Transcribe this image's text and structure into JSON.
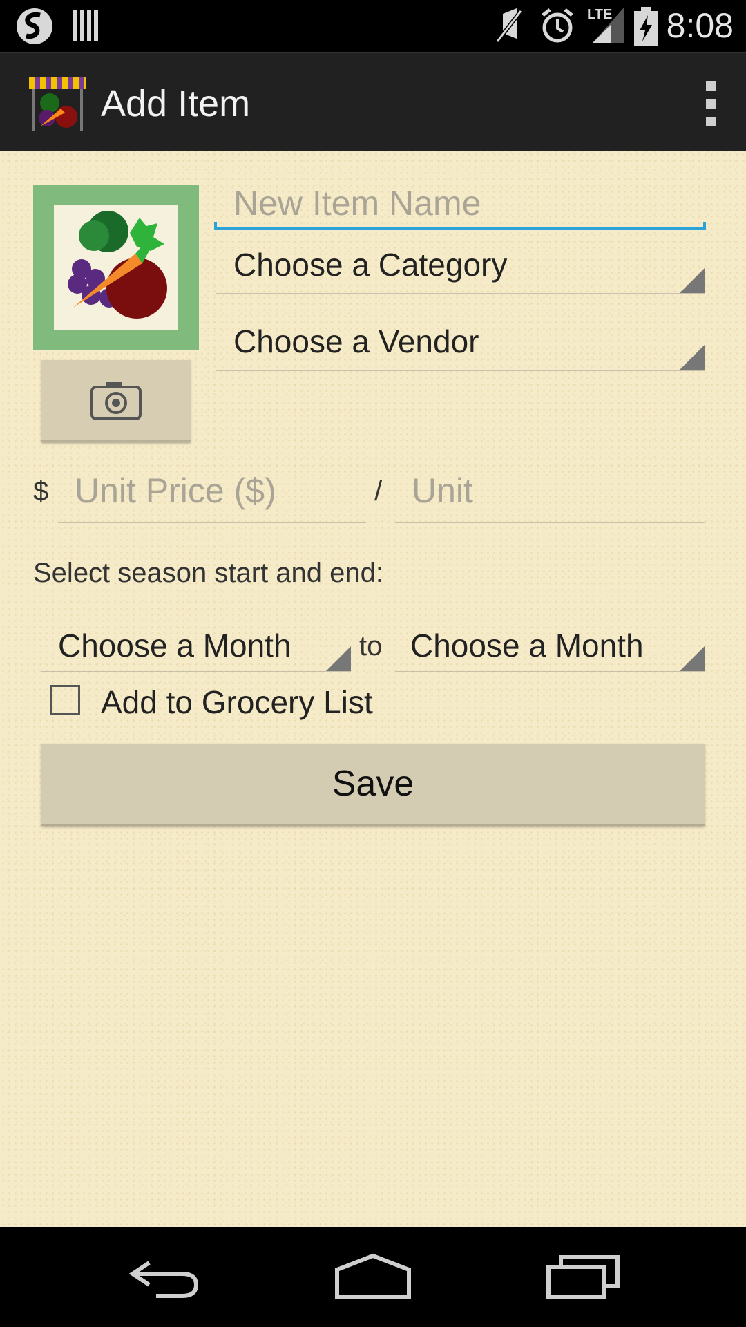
{
  "status_bar": {
    "time": "8:08",
    "network_label": "LTE",
    "icons": [
      "swype-icon",
      "barcode-icon",
      "mute-icon",
      "alarm-icon",
      "signal-icon",
      "battery-charging-icon"
    ]
  },
  "action_bar": {
    "title": "Add Item",
    "app_icon": "market-stall-icon",
    "overflow": "overflow-menu-icon"
  },
  "form": {
    "item_name_placeholder": "New Item Name",
    "category_spinner": "Choose a Category",
    "vendor_spinner": "Choose a Vendor",
    "currency_symbol": "$",
    "unit_price_placeholder": "Unit Price ($)",
    "slash": "/",
    "unit_placeholder": "Unit",
    "season_label": "Select season start and end:",
    "season_start": "Choose a Month",
    "season_to": "to",
    "season_end": "Choose a Month",
    "grocery_checkbox_label": "Add to Grocery List",
    "grocery_checked": false,
    "save_label": "Save"
  },
  "colors": {
    "background": "#f6ebc8",
    "accent": "#2aa3d8",
    "photo_frame": "#80bb7d",
    "button": "#d3cbb2"
  },
  "nav_bar": {
    "buttons": [
      "back-icon",
      "home-icon",
      "recents-icon"
    ]
  }
}
